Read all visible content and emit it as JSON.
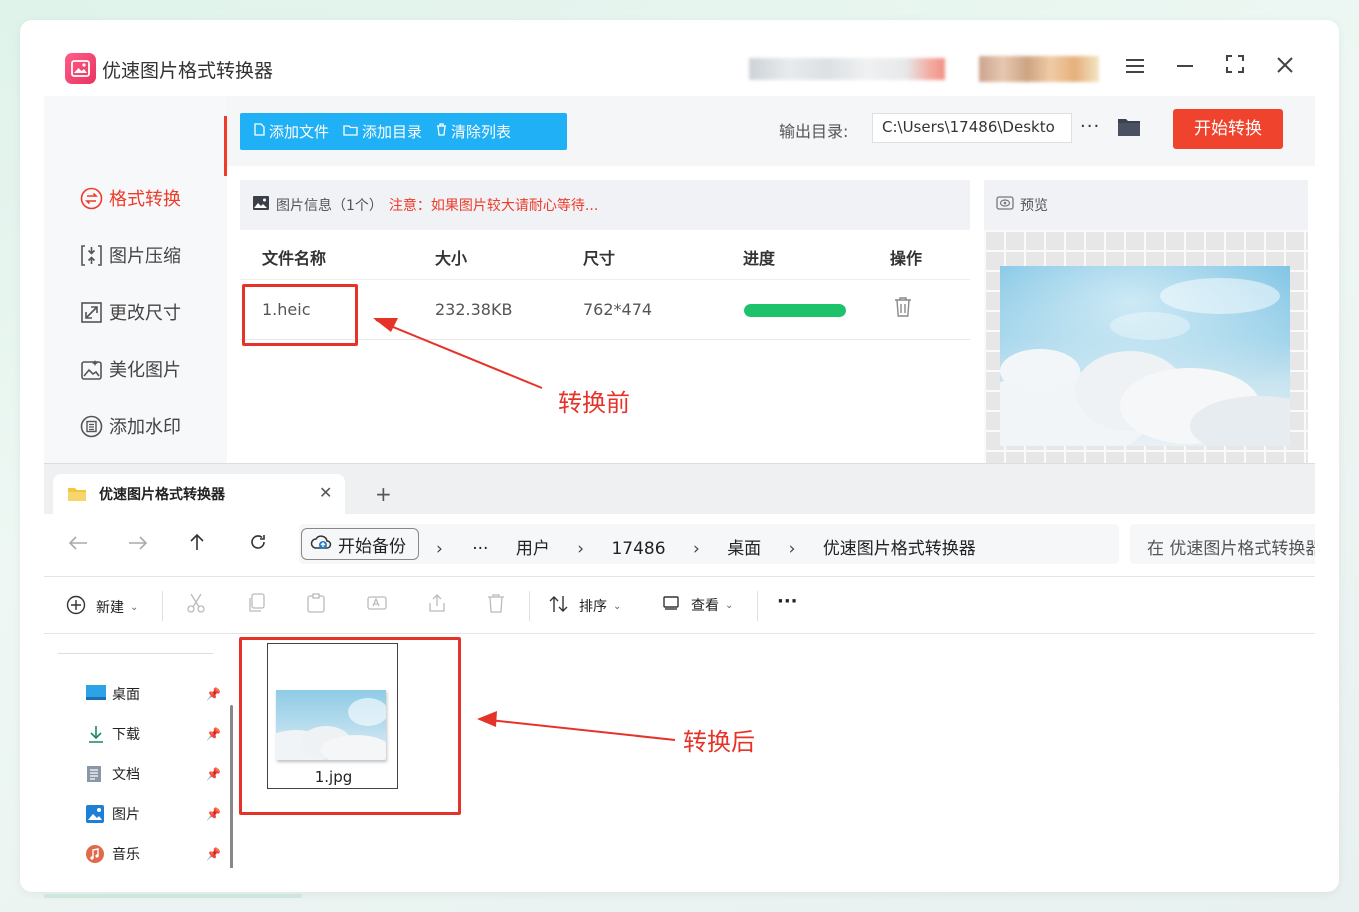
{
  "app": {
    "title": "优速图片格式转换器",
    "window_controls": [
      "menu-icon",
      "minimize-icon",
      "fullscreen-icon",
      "close-icon"
    ],
    "sidebar": [
      {
        "label": "格式转换",
        "icon": "convert-icon",
        "active": true
      },
      {
        "label": "图片压缩",
        "icon": "compress-icon",
        "active": false
      },
      {
        "label": "更改尺寸",
        "icon": "resize-icon",
        "active": false
      },
      {
        "label": "美化图片",
        "icon": "beautify-icon",
        "active": false
      },
      {
        "label": "添加水印",
        "icon": "watermark-icon",
        "active": false
      }
    ],
    "toolbar": {
      "add_file": "添加文件",
      "add_dir": "添加目录",
      "clear_list": "清除列表",
      "output_label": "输出目录:",
      "output_path": "C:\\Users\\17486\\Deskto",
      "more": "···",
      "start": "开始转换"
    },
    "info": {
      "label": "图片信息（1个）",
      "note": "注意：如果图片较大请耐心等待..."
    },
    "table": {
      "headers": [
        "文件名称",
        "大小",
        "尺寸",
        "进度",
        "操作"
      ],
      "rows": [
        {
          "name": "1.heic",
          "size": "232.38KB",
          "dims": "762*474",
          "progress": 1.0
        }
      ]
    },
    "preview_label": "预览",
    "annotation_before": "转换前",
    "colors": {
      "accent": "#ee3b2a",
      "blue": "#1fb0f5",
      "progress": "#1ec26b",
      "start": "#f0432d"
    }
  },
  "explorer": {
    "tab_title": "优速图片格式转换器",
    "tab_close": "✕",
    "tab_new": "+",
    "backup": "开始备份",
    "breadcrumbs": [
      "···",
      "用户",
      "17486",
      "桌面",
      "优速图片格式转换器"
    ],
    "search_placeholder": "在 优速图片格式转换器",
    "commands": {
      "new": "新建",
      "sort": "排序",
      "view": "查看",
      "more": "···"
    },
    "nav_items": [
      {
        "label": "桌面",
        "icon": "desktop-icon"
      },
      {
        "label": "下载",
        "icon": "download-icon"
      },
      {
        "label": "文档",
        "icon": "document-icon"
      },
      {
        "label": "图片",
        "icon": "pictures-icon"
      },
      {
        "label": "音乐",
        "icon": "music-icon"
      }
    ],
    "files": [
      {
        "name": "1.jpg"
      }
    ],
    "annotation_after": "转换后"
  }
}
